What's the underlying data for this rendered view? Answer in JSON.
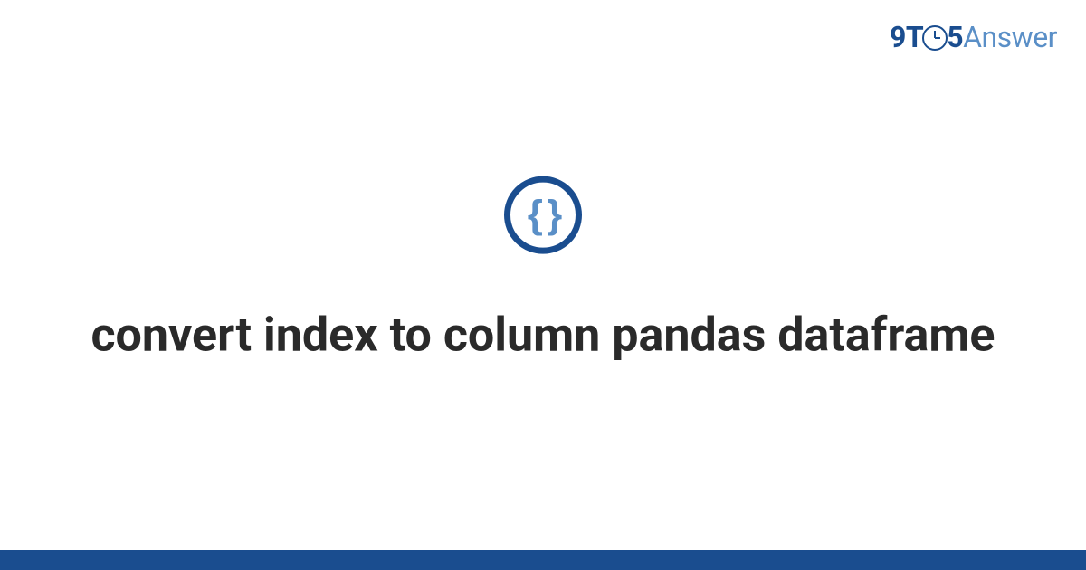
{
  "logo": {
    "part1": "9T",
    "part2": "5",
    "part3": "Answer"
  },
  "icon": {
    "braces": "{ }"
  },
  "title": "convert index to column pandas dataframe"
}
